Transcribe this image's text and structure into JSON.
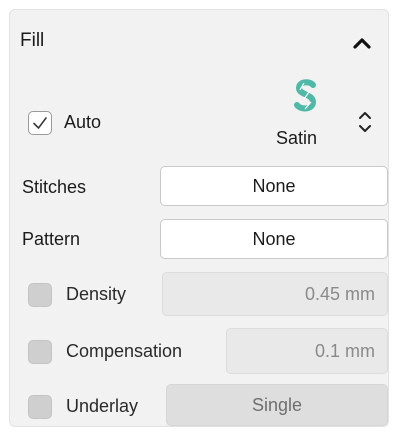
{
  "panel": {
    "title": "Fill"
  },
  "auto": {
    "label": "Auto",
    "checked": true
  },
  "stitch_type": {
    "label": "Satin",
    "icon": "satin-s-icon",
    "icon_color": "#4fb8a6"
  },
  "stitches": {
    "label": "Stitches",
    "value": "None"
  },
  "pattern": {
    "label": "Pattern",
    "value": "None"
  },
  "density": {
    "label": "Density",
    "value": "0.45 mm",
    "enabled": false
  },
  "compensation": {
    "label": "Compensation",
    "value": "0.1 mm",
    "enabled": false
  },
  "underlay": {
    "label": "Underlay",
    "value": "Single",
    "enabled": false
  }
}
